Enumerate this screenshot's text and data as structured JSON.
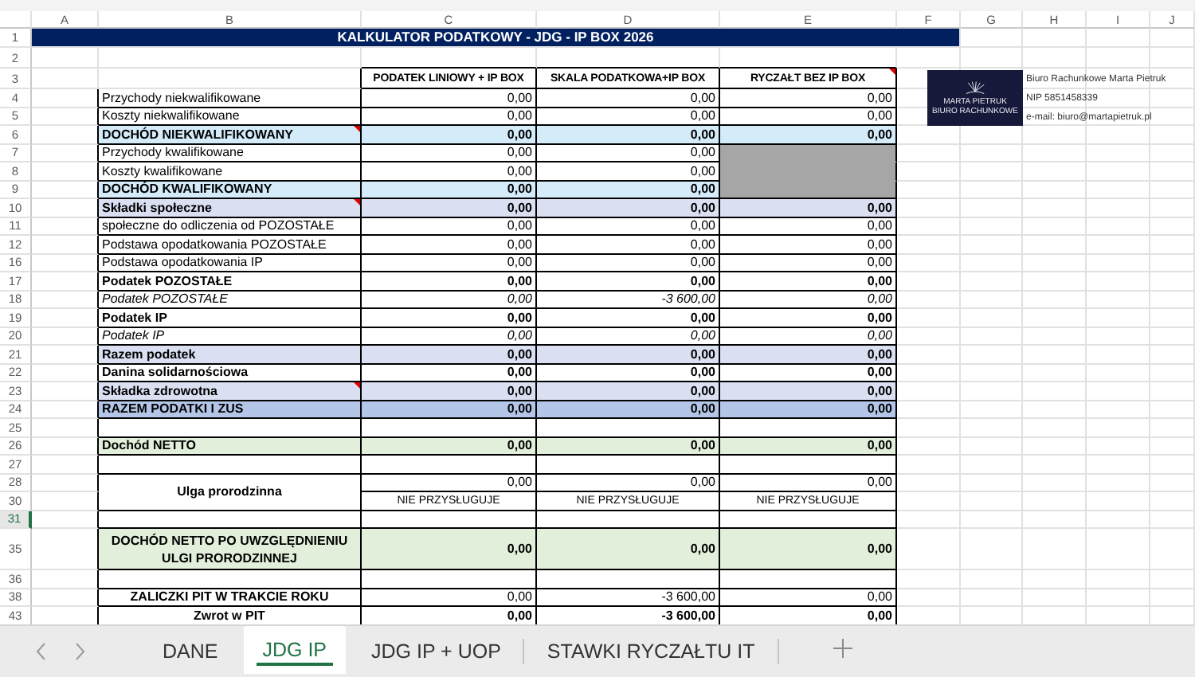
{
  "column_letters": [
    "A",
    "B",
    "C",
    "D",
    "E",
    "F",
    "G",
    "H",
    "I",
    "J"
  ],
  "rows": [
    {
      "number": "1",
      "kind": "title",
      "selected": false,
      "label": "KALKULATOR PODATKOWY - JDG - IP BOX 2026"
    },
    {
      "number": "2",
      "kind": "empty",
      "selected": false
    },
    {
      "number": "3",
      "kind": "headers",
      "selected": false,
      "columns": [
        {
          "label": "PODATEK LINIOWY + IP BOX",
          "note": false
        },
        {
          "label": "SKALA PODATKOWA+IP BOX",
          "note": false
        },
        {
          "label": "RYCZAŁT BEZ IP BOX",
          "note": true
        }
      ]
    },
    {
      "number": "4",
      "kind": "plain",
      "selected": false,
      "note": false,
      "label": "Przychody niekwalifikowane",
      "values": [
        "0,00",
        "0,00",
        "0,00"
      ]
    },
    {
      "number": "5",
      "kind": "plain",
      "selected": false,
      "note": false,
      "label": "Koszty niekwalifikowane",
      "values": [
        "0,00",
        "0,00",
        "0,00"
      ]
    },
    {
      "number": "6",
      "kind": "income",
      "selected": false,
      "note": true,
      "label": "DOCHÓD NIEKWALIFIKOWANY",
      "values": [
        "0,00",
        "0,00",
        "0,00"
      ]
    },
    {
      "number": "7",
      "kind": "plain",
      "selected": false,
      "note": false,
      "label": "Przychody kwalifikowane",
      "values": [
        "0,00",
        "0,00"
      ]
    },
    {
      "number": "8",
      "kind": "plain",
      "selected": false,
      "note": false,
      "label": "Koszty kwalifikowane",
      "values": [
        "0,00",
        "0,00"
      ]
    },
    {
      "number": "9",
      "kind": "income",
      "selected": false,
      "note": false,
      "label": "DOCHÓD KWALIFIKOWANY",
      "values": [
        "0,00",
        "0,00"
      ]
    },
    {
      "number": "10",
      "kind": "section",
      "selected": false,
      "note": true,
      "label": "Składki społeczne",
      "values": [
        "0,00",
        "0,00",
        "0,00"
      ]
    },
    {
      "number": "11",
      "kind": "plain",
      "selected": false,
      "note": false,
      "label": "społeczne do odliczenia od POZOSTAŁE",
      "values": [
        "0,00",
        "0,00",
        "0,00"
      ]
    },
    {
      "number": "12",
      "kind": "plain",
      "selected": false,
      "note": false,
      "label": "Podstawa  opodatkowania POZOSTAŁE",
      "values": [
        "0,00",
        "0,00",
        "0,00"
      ]
    },
    {
      "number": "16",
      "kind": "plain",
      "selected": false,
      "note": false,
      "label": "Podstawa opodatkowania IP",
      "values": [
        "0,00",
        "0,00",
        "0,00"
      ]
    },
    {
      "number": "17",
      "kind": "bold",
      "selected": false,
      "note": false,
      "label": "Podatek POZOSTAŁE",
      "values": [
        "0,00",
        "0,00",
        "0,00"
      ]
    },
    {
      "number": "18",
      "kind": "italic",
      "selected": false,
      "note": false,
      "label": "Podatek POZOSTAŁE",
      "values": [
        "0,00",
        "-3 600,00",
        "0,00"
      ]
    },
    {
      "number": "19",
      "kind": "bold",
      "selected": false,
      "note": false,
      "label": "Podatek IP",
      "values": [
        "0,00",
        "0,00",
        "0,00"
      ]
    },
    {
      "number": "20",
      "kind": "italic",
      "selected": false,
      "note": false,
      "label": "Podatek IP",
      "values": [
        "0,00",
        "0,00",
        "0,00"
      ]
    },
    {
      "number": "21",
      "kind": "section",
      "selected": false,
      "note": false,
      "label": "Razem podatek",
      "values": [
        "0,00",
        "0,00",
        "0,00"
      ]
    },
    {
      "number": "22",
      "kind": "bold",
      "selected": false,
      "note": false,
      "label": "Danina solidarnościowa",
      "values": [
        "0,00",
        "0,00",
        "0,00"
      ]
    },
    {
      "number": "23",
      "kind": "section",
      "selected": false,
      "note": true,
      "label": "Składka zdrowotna",
      "values": [
        "0,00",
        "0,00",
        "0,00"
      ]
    },
    {
      "number": "24",
      "kind": "grand",
      "selected": false,
      "note": false,
      "label": "RAZEM PODATKI I ZUS",
      "values": [
        "0,00",
        "0,00",
        "0,00"
      ]
    },
    {
      "number": "25",
      "kind": "blank",
      "selected": false
    },
    {
      "number": "26",
      "kind": "net",
      "selected": false,
      "note": false,
      "label": "Dochód NETTO",
      "values": [
        "0,00",
        "0,00",
        "0,00"
      ]
    },
    {
      "number": "27",
      "kind": "blank",
      "selected": false
    },
    {
      "number": "28",
      "kind": "relief",
      "selected": false,
      "note": false,
      "label": "Ulga prorodzinna",
      "values": [
        "0,00",
        "0,00",
        "0,00"
      ]
    },
    {
      "number": "30",
      "kind": "notice",
      "selected": false,
      "values": [
        "NIE PRZYSŁUGUJE",
        "NIE PRZYSŁUGUJE",
        "NIE PRZYSŁUGUJE"
      ]
    },
    {
      "number": "31",
      "kind": "blank",
      "selected": true
    },
    {
      "number": "35",
      "kind": "final",
      "selected": false,
      "note": false,
      "label": "DOCHÓD NETTO PO UWZGLĘDNIENIU ULGI PRORODZINNEJ",
      "values": [
        "0,00",
        "0,00",
        "0,00"
      ]
    },
    {
      "number": "36",
      "kind": "blank",
      "selected": false
    },
    {
      "number": "38",
      "kind": "summary",
      "selected": false,
      "note": false,
      "label": "ZALICZKI PIT  W TRAKCIE ROKU",
      "values": [
        "0,00",
        "-3 600,00",
        "0,00"
      ]
    },
    {
      "number": "43",
      "kind": "summary-bold",
      "selected": false,
      "note": false,
      "label": "Zwrot w PIT",
      "values": [
        "0,00",
        "-3 600,00",
        "0,00"
      ]
    }
  ],
  "logo": {
    "lines": [
      "MARTA PIETRUK",
      "BIURO RACHUNKOWE"
    ]
  },
  "company_info": [
    "Biuro Rachunkowe Marta Pietruk",
    "NIP 5851458339",
    "e-mail: biuro@martapietruk.pl"
  ],
  "sheet_tabs": [
    {
      "label": "DANE",
      "selected": false
    },
    {
      "label": "JDG IP",
      "selected": true
    },
    {
      "label": "JDG IP + UOP",
      "selected": false
    },
    {
      "label": "STAWKI RYCZAŁTU IT",
      "selected": false
    }
  ]
}
